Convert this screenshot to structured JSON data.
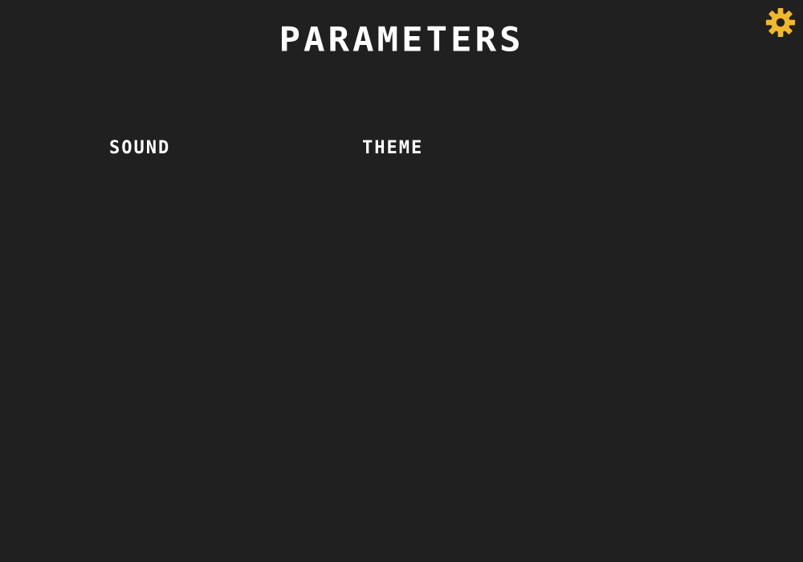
{
  "header": {
    "title": "Parameters",
    "settings_icon": "gear-icon",
    "settings_icon_color": "#F0B82A"
  },
  "sections": {
    "sound_label": "Sound",
    "theme_label": "Theme"
  },
  "colors": {
    "background": "#202020",
    "text": "#FFFFFF"
  }
}
